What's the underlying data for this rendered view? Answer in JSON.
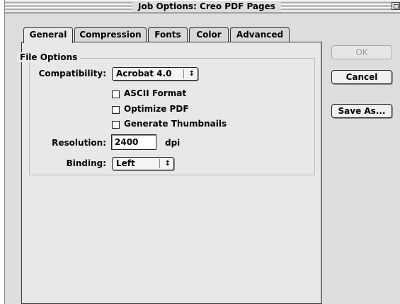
{
  "window": {
    "title": "Job Options: Creo PDF Pages"
  },
  "tabs": [
    {
      "label": "General"
    },
    {
      "label": "Compression"
    },
    {
      "label": "Fonts"
    },
    {
      "label": "Color"
    },
    {
      "label": "Advanced"
    }
  ],
  "file_options": {
    "group_title": "File Options",
    "compatibility_label": "Compatibility:",
    "compatibility_value": "Acrobat 4.0",
    "checkboxes": [
      {
        "label": "ASCII Format",
        "checked": false
      },
      {
        "label": "Optimize PDF",
        "checked": false
      },
      {
        "label": "Generate Thumbnails",
        "checked": false
      }
    ],
    "resolution_label": "Resolution:",
    "resolution_value": "2400",
    "resolution_unit": "dpi",
    "binding_label": "Binding:",
    "binding_value": "Left"
  },
  "buttons": {
    "ok": "OK",
    "cancel": "Cancel",
    "save_as": "Save As..."
  },
  "icons": {
    "popup_arrow": "updown-arrows-icon",
    "zoom": "zoom-box-icon"
  }
}
